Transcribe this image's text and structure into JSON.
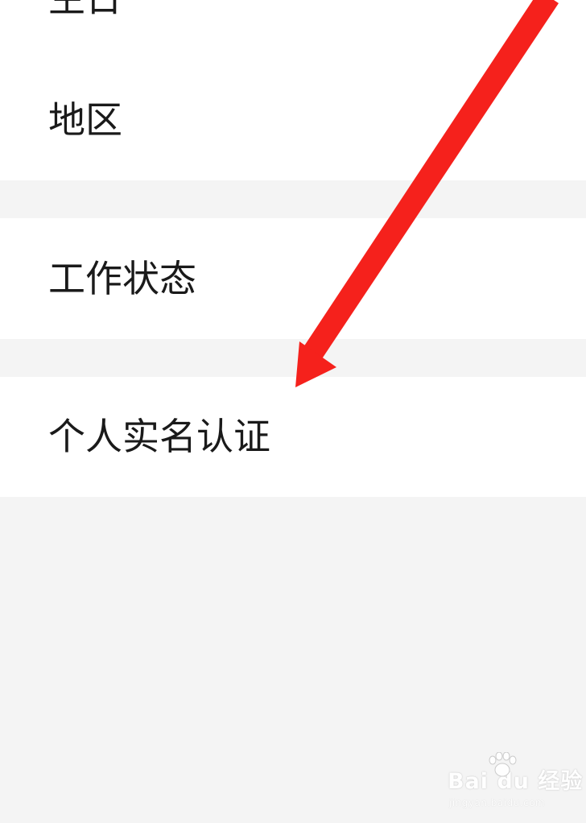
{
  "settings": {
    "rows": {
      "birthday": "生日",
      "region": "地区",
      "work_status": "工作状态",
      "real_name_verification": "个人实名认证"
    }
  },
  "annotation": {
    "arrow_color": "#f5211c",
    "points_to": "real_name_verification"
  },
  "watermark": {
    "logo_text": "Bai du 经验",
    "url": "jingyan.baidu.com"
  },
  "colors": {
    "background": "#f4f4f4",
    "card": "#ffffff",
    "text": "#1a1a1a"
  }
}
